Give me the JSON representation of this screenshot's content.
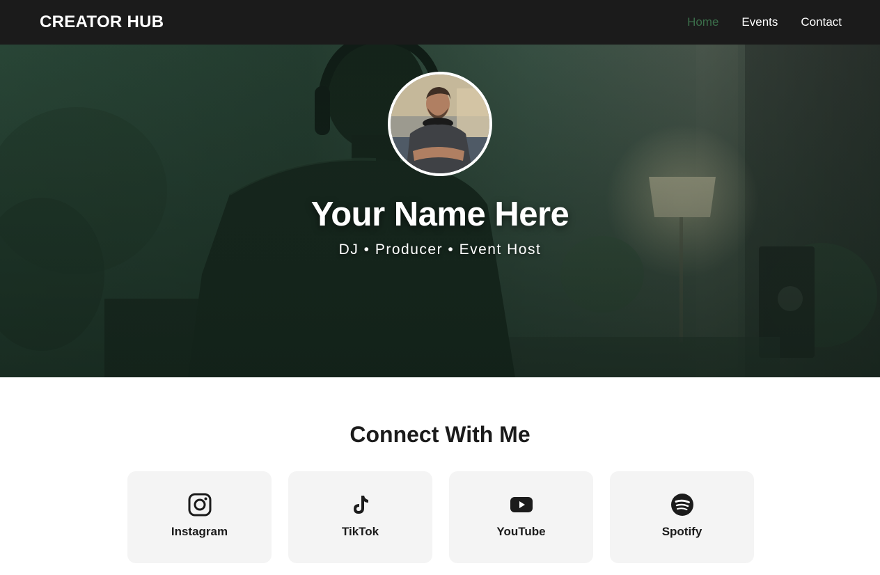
{
  "nav": {
    "brand": "CREATOR HUB",
    "links": [
      {
        "label": "Home",
        "active": true
      },
      {
        "label": "Events",
        "active": false
      },
      {
        "label": "Contact",
        "active": false
      }
    ],
    "active_color": "#3b6e4a"
  },
  "hero": {
    "name": "Your Name Here",
    "tagline": "DJ • Producer • Event Host"
  },
  "connect": {
    "title": "Connect With Me",
    "cards": [
      {
        "label": "Instagram",
        "icon": "instagram-icon"
      },
      {
        "label": "TikTok",
        "icon": "tiktok-icon"
      },
      {
        "label": "YouTube",
        "icon": "youtube-icon"
      },
      {
        "label": "Spotify",
        "icon": "spotify-icon"
      }
    ]
  }
}
